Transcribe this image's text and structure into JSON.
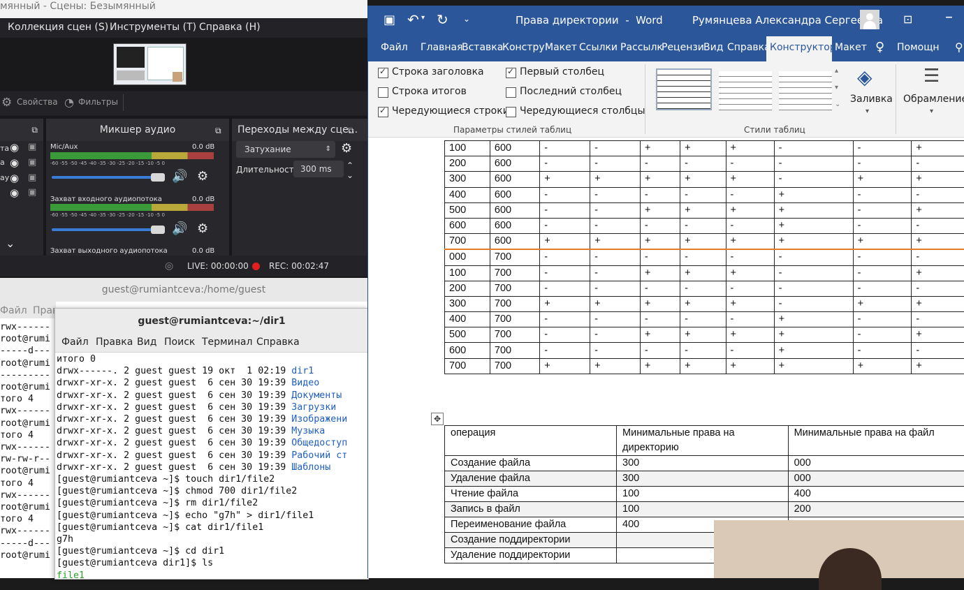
{
  "obs": {
    "title": "мянный - Сцены: Безымянный",
    "menu": [
      "Коллекция сцен (S)",
      "Инструменты (T)",
      "Справка (H)"
    ],
    "toolbar": {
      "properties": "Свойства",
      "filters": "Фильтры"
    },
    "mixer": {
      "title": "Микшер аудио",
      "channels": [
        {
          "name": "Mic/Aux",
          "db": "0.0 dB"
        },
        {
          "name": "Захват входного аудиопотока",
          "db": "0.0 dB"
        },
        {
          "name": "Захват выходного аудиопотока",
          "db": "0.0 dB"
        }
      ],
      "scale": "-60 -55 -50 -45 -40 -35 -30 -25 -20 -15 -10 -5 0"
    },
    "transitions": {
      "title": "Переходы между сце...",
      "type": "Затухание",
      "duration_label": "Длительность",
      "duration_value": "300 ms"
    },
    "status": {
      "live": "LIVE: 00:00:00",
      "rec": "REC: 00:02:47"
    },
    "sources_partial": [
      "та",
      "а",
      "ау",
      ""
    ]
  },
  "term_back": {
    "title": "guest@rumiantceva:/home/guest",
    "menu": [
      "Файл",
      "Прав"
    ],
    "lines": [
      "rwx------",
      "root@rumi",
      "-----d---",
      "root@rumi",
      "---------",
      "root@rumi",
      "того 4",
      "rwx------",
      "root@rumi",
      "того 4",
      "rwx------",
      "rw-rw-r--",
      "root@rumi",
      "того 4",
      "rwx------",
      "root@rumi",
      "того 4",
      "rwx------",
      "-----d---",
      "root@rumi"
    ]
  },
  "term_front": {
    "title": "guest@rumiantceva:~/dir1",
    "menu": [
      "Файл",
      "Правка",
      "Вид",
      "Поиск",
      "Терминал",
      "Справка"
    ],
    "lines": [
      {
        "text": "итого 0",
        "link": ""
      },
      {
        "text": "drwx------. 2 guest guest 19 окт  1 02:19 ",
        "link": "dir1"
      },
      {
        "text": "drwxr-xr-x. 2 guest guest  6 сен 30 19:39 ",
        "link": "Видео"
      },
      {
        "text": "drwxr-xr-x. 2 guest guest  6 сен 30 19:39 ",
        "link": "Документы"
      },
      {
        "text": "drwxr-xr-x. 2 guest guest  6 сен 30 19:39 ",
        "link": "Загрузки"
      },
      {
        "text": "drwxr-xr-x. 2 guest guest  6 сен 30 19:39 ",
        "link": "Изображени"
      },
      {
        "text": "drwxr-xr-x. 2 guest guest  6 сен 30 19:39 ",
        "link": "Музыка"
      },
      {
        "text": "drwxr-xr-x. 2 guest guest  6 сен 30 19:39 ",
        "link": "Общедоступ"
      },
      {
        "text": "drwxr-xr-x. 2 guest guest  6 сен 30 19:39 ",
        "link": "Рабочий ст"
      },
      {
        "text": "drwxr-xr-x. 2 guest guest  6 сен 30 19:39 ",
        "link": "Шаблоны"
      },
      {
        "text": "[guest@rumiantceva ~]$ touch dir1/file2",
        "link": ""
      },
      {
        "text": "[guest@rumiantceva ~]$ chmod 700 dir1/file2",
        "link": ""
      },
      {
        "text": "[guest@rumiantceva ~]$ rm dir1/file2",
        "link": ""
      },
      {
        "text": "[guest@rumiantceva ~]$ echo \"g7h\" > dir1/file1",
        "link": ""
      },
      {
        "text": "[guest@rumiantceva ~]$ cat dir1/file1",
        "link": ""
      },
      {
        "text": "g7h",
        "link": ""
      },
      {
        "text": "[guest@rumiantceva ~]$ cd dir1",
        "link": ""
      },
      {
        "text": "[guest@rumiantceva dir1]$ ls",
        "link": ""
      },
      {
        "text": "",
        "link": "file1"
      }
    ]
  },
  "word": {
    "title": "Права директории  -  Word",
    "user": "Румянцева Александра Сергеевна",
    "tabs": [
      "Файл",
      "Главная",
      "Вставка",
      "Констру",
      "Макет",
      "Ссылки",
      "Рассылк",
      "Рецензи",
      "Вид",
      "Справка",
      "Конструктор",
      "Макет",
      "Помощн"
    ],
    "active_tab": "Конструктор",
    "style_options": [
      {
        "label": "Строка заголовка",
        "checked": true
      },
      {
        "label": "Строка итогов",
        "checked": false
      },
      {
        "label": "Чередующиеся строки",
        "checked": true
      },
      {
        "label": "Первый столбец",
        "checked": true
      },
      {
        "label": "Последний столбец",
        "checked": false
      },
      {
        "label": "Чередующиеся столбцы",
        "checked": false
      }
    ],
    "group_style_options": "Параметры стилей таблиц",
    "group_table_styles": "Стили таблиц",
    "fill_label": "Заливка",
    "border_label": "Обрамление",
    "perm_table": [
      [
        "100",
        "600",
        "-",
        "-",
        "+",
        "+",
        "+",
        "-",
        "-",
        "+"
      ],
      [
        "200",
        "600",
        "-",
        "-",
        "-",
        "-",
        "-",
        "-",
        "-",
        "-"
      ],
      [
        "300",
        "600",
        "+",
        "+",
        "+",
        "+",
        "+",
        "-",
        "+",
        "+"
      ],
      [
        "400",
        "600",
        "-",
        "-",
        "-",
        "-",
        "-",
        "+",
        "-",
        "-"
      ],
      [
        "500",
        "600",
        "-",
        "-",
        "+",
        "+",
        "+",
        "+",
        "-",
        "+"
      ],
      [
        "600",
        "600",
        "-",
        "-",
        "-",
        "-",
        "-",
        "+",
        "-",
        "-"
      ],
      [
        "700",
        "600",
        "+",
        "+",
        "+",
        "+",
        "+",
        "+",
        "+",
        "+"
      ],
      [
        "000",
        "700",
        "-",
        "-",
        "-",
        "-",
        "-",
        "-",
        "-",
        "-"
      ],
      [
        "100",
        "700",
        "-",
        "-",
        "+",
        "+",
        "+",
        "-",
        "-",
        "+"
      ],
      [
        "200",
        "700",
        "-",
        "-",
        "-",
        "-",
        "-",
        "-",
        "-",
        "-"
      ],
      [
        "300",
        "700",
        "+",
        "+",
        "+",
        "+",
        "+",
        "-",
        "+",
        "+"
      ],
      [
        "400",
        "700",
        "-",
        "-",
        "-",
        "-",
        "-",
        "+",
        "-",
        "-"
      ],
      [
        "500",
        "700",
        "-",
        "-",
        "+",
        "+",
        "+",
        "+",
        "-",
        "+"
      ],
      [
        "600",
        "700",
        "-",
        "-",
        "-",
        "-",
        "-",
        "+",
        "-",
        "-"
      ],
      [
        "700",
        "700",
        "+",
        "+",
        "+",
        "+",
        "+",
        "+",
        "+",
        "+"
      ]
    ],
    "ops_table": {
      "headers": [
        "операция",
        "Минимальные права на директорию",
        "Минимальные права на файл"
      ],
      "rows": [
        [
          "Создание файла",
          "300",
          "000"
        ],
        [
          "Удаление файла",
          "300",
          "000"
        ],
        [
          "Чтение файла",
          "100",
          "400"
        ],
        [
          "Запись в файл",
          "100",
          "200"
        ],
        [
          "Переименование файла",
          "400",
          ""
        ],
        [
          "Создание поддиректории",
          "",
          ""
        ],
        [
          "Удаление поддиректории",
          "",
          ""
        ]
      ]
    }
  }
}
